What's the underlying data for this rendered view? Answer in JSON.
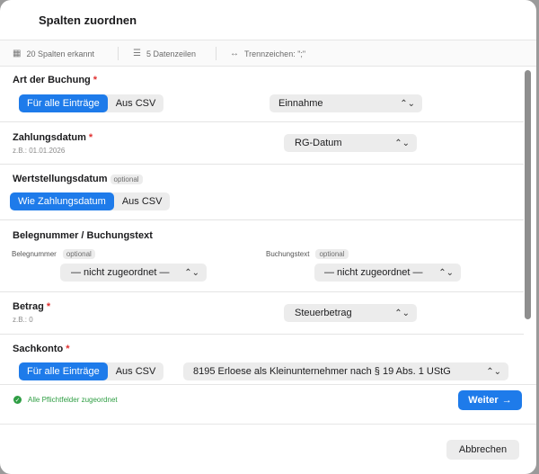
{
  "dialog": {
    "title": "Spalten zuordnen"
  },
  "infobar": {
    "columns": "20 Spalten erkannt",
    "rows": "5 Datenzeilen",
    "delimiter": "Trennzeichen: \";\""
  },
  "fields": {
    "art": {
      "label": "Art der Buchung",
      "seg_all": "Für alle Einträge",
      "seg_csv": "Aus CSV",
      "select": "Einnahme"
    },
    "zahlungsdatum": {
      "label": "Zahlungsdatum",
      "hint": "z.B.: 01.01.2026",
      "select": "RG-Datum"
    },
    "wertstellung": {
      "label": "Wertstellungsdatum",
      "badge": "optional",
      "seg_same": "Wie Zahlungsdatum",
      "seg_csv": "Aus CSV"
    },
    "beleg": {
      "label": "Belegnummer / Buchungstext",
      "sub1": "Belegnummer",
      "sub1_badge": "optional",
      "select1": "— nicht zugeordnet —",
      "sub2": "Buchungstext",
      "sub2_badge": "optional",
      "select2": "— nicht zugeordnet —"
    },
    "betrag": {
      "label": "Betrag",
      "hint": "z.B.: 0",
      "select": "Steuerbetrag"
    },
    "sachkonto": {
      "label": "Sachkonto",
      "seg_all": "Für alle Einträge",
      "seg_csv": "Aus CSV",
      "select": "8195  Erloese als Kleinunternehmer nach § 19 Abs. 1 UStG"
    },
    "required_mark": "*"
  },
  "footer": {
    "status": "Alle Pflichtfelder zugeordnet",
    "next": "Weiter",
    "next_arrow": "→",
    "cancel": "Abbrechen"
  },
  "colors": {
    "accent": "#1e7bea",
    "success": "#2f9e44",
    "required": "#e03131"
  }
}
